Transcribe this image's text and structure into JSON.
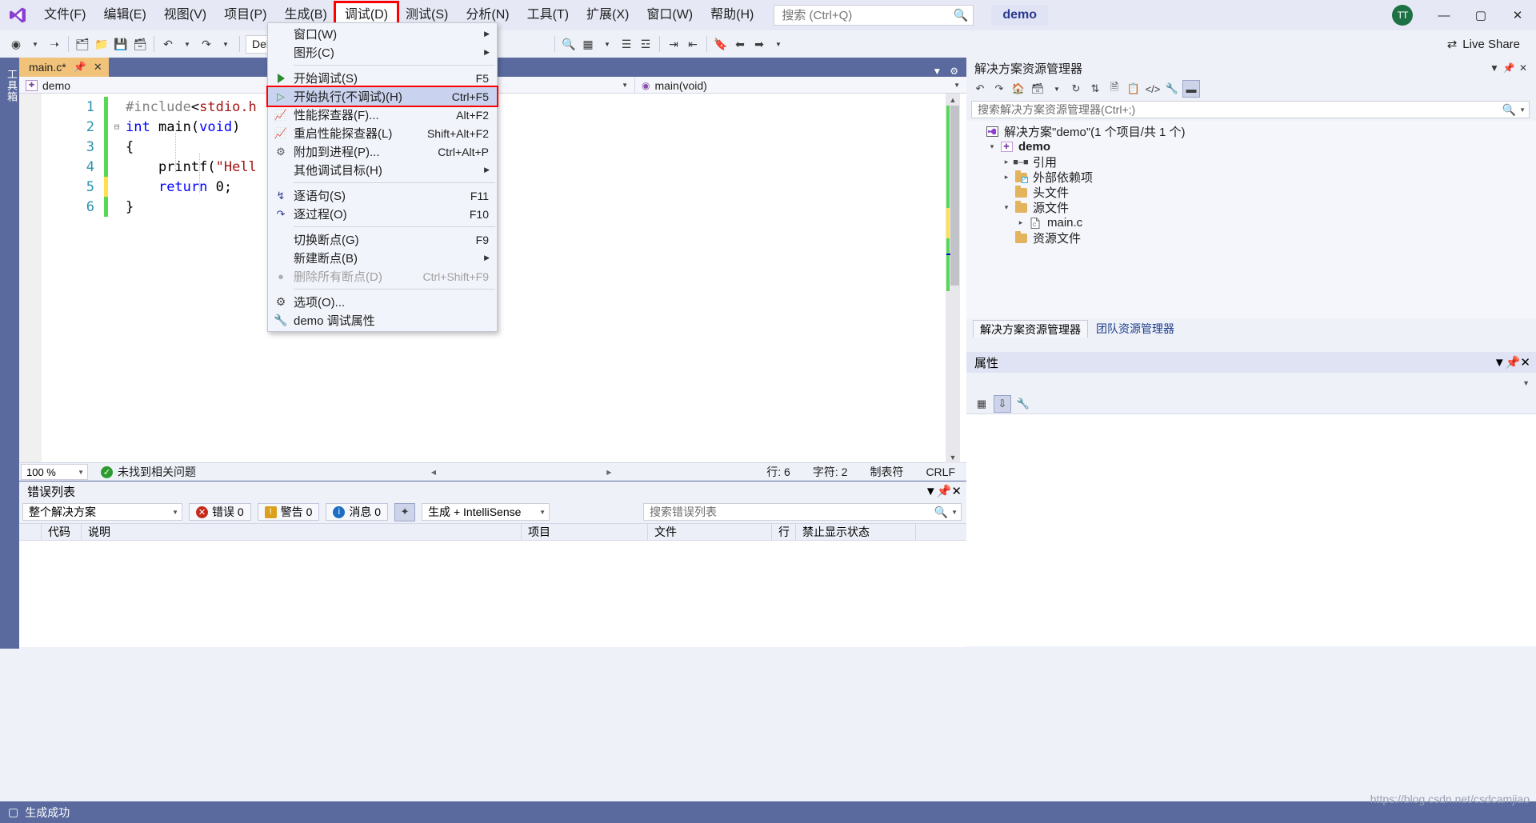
{
  "titlebar": {
    "logo_icon": "visual-studio-logo-icon",
    "menus": [
      {
        "label": "文件(F)",
        "active": false
      },
      {
        "label": "编辑(E)",
        "active": false
      },
      {
        "label": "视图(V)",
        "active": false
      },
      {
        "label": "项目(P)",
        "active": false
      },
      {
        "label": "生成(B)",
        "active": false
      },
      {
        "label": "调试(D)",
        "active": true
      },
      {
        "label": "测试(S)",
        "active": false
      },
      {
        "label": "分析(N)",
        "active": false
      },
      {
        "label": "工具(T)",
        "active": false
      },
      {
        "label": "扩展(X)",
        "active": false
      },
      {
        "label": "窗口(W)",
        "active": false
      },
      {
        "label": "帮助(H)",
        "active": false
      }
    ],
    "search_placeholder": "搜索 (Ctrl+Q)",
    "search_icon": "search-icon",
    "solution_chip": "demo",
    "avatar_initials": "TT",
    "minimize": "—",
    "maximize": "▢",
    "close": "✕"
  },
  "toolbar": {
    "config": "Debug",
    "live_share": "Live Share",
    "live_share_icon": "live-share-icon"
  },
  "left_rail": {
    "label": "工具箱"
  },
  "editor": {
    "tab_title": "main.c*",
    "pin_icon": "pin-icon",
    "close_icon": "close-icon",
    "nav_left": "demo",
    "nav_right": "main(void)",
    "lines": [
      {
        "no": "1",
        "change": "green",
        "fold": "",
        "tokens": [
          {
            "t": "#include",
            "c": "k-gray"
          },
          {
            "t": "<",
            "c": "k-dark"
          },
          {
            "t": "stdio.h",
            "c": "k-str"
          }
        ]
      },
      {
        "no": "2",
        "change": "green",
        "fold": "-",
        "tokens": [
          {
            "t": "int",
            "c": "k-blue"
          },
          {
            "t": " main(",
            "c": "k-dark"
          },
          {
            "t": "void",
            "c": "k-blue"
          },
          {
            "t": ")",
            "c": "k-dark"
          }
        ]
      },
      {
        "no": "3",
        "change": "green",
        "fold": "",
        "tokens": [
          {
            "t": "{",
            "c": "k-dark"
          }
        ]
      },
      {
        "no": "4",
        "change": "green",
        "fold": "",
        "tokens": [
          {
            "t": "    printf(",
            "c": "k-dark"
          },
          {
            "t": "\"Hell",
            "c": "k-str"
          }
        ]
      },
      {
        "no": "5",
        "change": "yellow",
        "fold": "",
        "tokens": [
          {
            "t": "    ",
            "c": "k-dark"
          },
          {
            "t": "return",
            "c": "k-blue"
          },
          {
            "t": " 0;",
            "c": "k-dark"
          }
        ]
      },
      {
        "no": "6",
        "change": "green",
        "fold": "",
        "tokens": [
          {
            "t": "}",
            "c": "k-dark"
          }
        ]
      }
    ],
    "zoom": "100 %",
    "issue_status": "未找到相关问题",
    "issue_status_icon": "check-circle-icon",
    "line_status": "行: 6",
    "col_status": "字符: 2",
    "tab_status": "制表符",
    "eol_status": "CRLF"
  },
  "debug_menu": {
    "items": [
      {
        "label": "窗口(W)",
        "key": "",
        "icon": "",
        "submenu": true,
        "highlight": false,
        "disabled": false
      },
      {
        "label": "图形(C)",
        "key": "",
        "icon": "",
        "submenu": true,
        "highlight": false,
        "disabled": false
      },
      {
        "sep": true
      },
      {
        "label": "开始调试(S)",
        "key": "F5",
        "icon": "play-icon",
        "submenu": false,
        "highlight": false,
        "disabled": false
      },
      {
        "label": "开始执行(不调试)(H)",
        "key": "Ctrl+F5",
        "icon": "play-outline-icon",
        "submenu": false,
        "highlight": true,
        "disabled": false
      },
      {
        "label": "性能探查器(F)...",
        "key": "Alt+F2",
        "icon": "perf-icon",
        "submenu": false,
        "highlight": false,
        "disabled": false
      },
      {
        "label": "重启性能探查器(L)",
        "key": "Shift+Alt+F2",
        "icon": "perf-icon",
        "submenu": false,
        "highlight": false,
        "disabled": false
      },
      {
        "label": "附加到进程(P)...",
        "key": "Ctrl+Alt+P",
        "icon": "gears-icon",
        "submenu": false,
        "highlight": false,
        "disabled": false
      },
      {
        "label": "其他调试目标(H)",
        "key": "",
        "icon": "",
        "submenu": true,
        "highlight": false,
        "disabled": false
      },
      {
        "sep": true
      },
      {
        "label": "逐语句(S)",
        "key": "F11",
        "icon": "step-into-icon",
        "submenu": false,
        "highlight": false,
        "disabled": false
      },
      {
        "label": "逐过程(O)",
        "key": "F10",
        "icon": "step-over-icon",
        "submenu": false,
        "highlight": false,
        "disabled": false
      },
      {
        "sep": true
      },
      {
        "label": "切换断点(G)",
        "key": "F9",
        "icon": "",
        "submenu": false,
        "highlight": false,
        "disabled": false
      },
      {
        "label": "新建断点(B)",
        "key": "",
        "icon": "",
        "submenu": true,
        "highlight": false,
        "disabled": false
      },
      {
        "label": "删除所有断点(D)",
        "key": "Ctrl+Shift+F9",
        "icon": "delete-breakpoints-icon",
        "submenu": false,
        "highlight": false,
        "disabled": true
      },
      {
        "sep": true
      },
      {
        "label": "选项(O)...",
        "key": "",
        "icon": "gear-icon",
        "submenu": false,
        "highlight": false,
        "disabled": false
      },
      {
        "label": "demo 调试属性",
        "key": "",
        "icon": "wrench-icon",
        "submenu": false,
        "highlight": false,
        "disabled": false
      }
    ]
  },
  "solution_explorer": {
    "title": "解决方案资源管理器",
    "search_placeholder": "搜索解决方案资源管理器(Ctrl+;)",
    "tree": [
      {
        "indent": 0,
        "arrow": "",
        "icon": "solution-icon",
        "label": "解决方案\"demo\"(1 个项目/共 1 个)",
        "bold": false
      },
      {
        "indent": 1,
        "arrow": "▾",
        "icon": "project-icon",
        "label": "demo",
        "bold": true
      },
      {
        "indent": 2,
        "arrow": "▸",
        "icon": "references-icon",
        "label": "引用",
        "bold": false
      },
      {
        "indent": 2,
        "arrow": "▸",
        "icon": "external-deps-icon",
        "label": "外部依赖项",
        "bold": false
      },
      {
        "indent": 2,
        "arrow": "",
        "icon": "folder-icon",
        "label": "头文件",
        "bold": false
      },
      {
        "indent": 2,
        "arrow": "▾",
        "icon": "folder-icon",
        "label": "源文件",
        "bold": false
      },
      {
        "indent": 3,
        "arrow": "▸",
        "icon": "c-file-icon",
        "label": "main.c",
        "bold": false
      },
      {
        "indent": 2,
        "arrow": "",
        "icon": "folder-icon",
        "label": "资源文件",
        "bold": false
      }
    ],
    "tabs": [
      {
        "label": "解决方案资源管理器",
        "active": true
      },
      {
        "label": "团队资源管理器",
        "active": false
      }
    ]
  },
  "properties": {
    "title": "属性"
  },
  "error_list": {
    "title": "错误列表",
    "scope": "整个解决方案",
    "filters": [
      {
        "label": "错误 0",
        "icon": "error-icon",
        "color": "#c42b1c"
      },
      {
        "label": "警告 0",
        "icon": "warning-icon",
        "color": "#dba11c"
      },
      {
        "label": "消息 0",
        "icon": "info-icon",
        "color": "#1b6ec2"
      }
    ],
    "build_filter_icon": "build-intellisense-icon",
    "build_filter": "生成 + IntelliSense",
    "search_placeholder": "搜索错误列表",
    "columns": [
      "",
      "代码",
      "说明",
      "项目",
      "文件",
      "行",
      "禁止显示状态"
    ]
  },
  "statusbar": {
    "message": "生成成功",
    "watermark": "https://blog.csdn.net/csdcamjiao"
  }
}
